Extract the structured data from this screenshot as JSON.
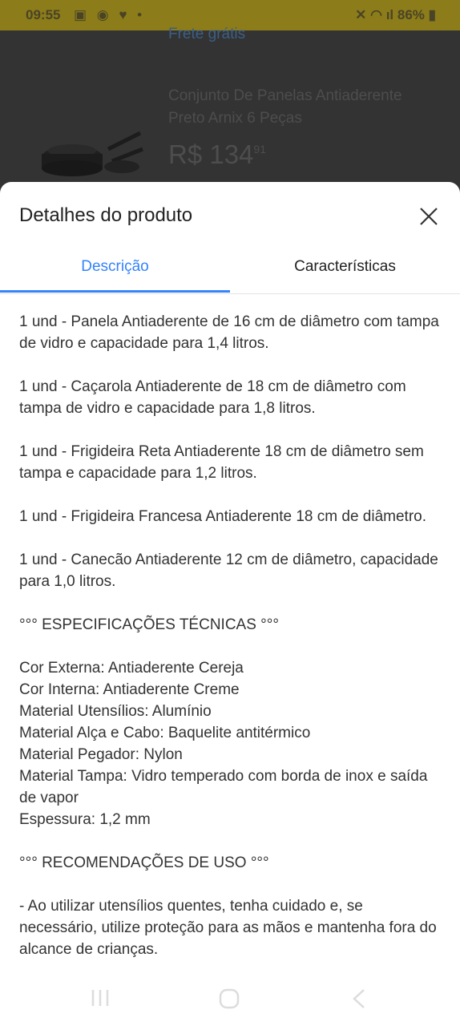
{
  "status": {
    "time": "09:55",
    "battery": "86%"
  },
  "background": {
    "shipping": "Frete grátis",
    "product_name": "Conjunto De Panelas Antiaderente Preto Arnix 6 Peças",
    "price_main": "R$ 134",
    "price_cents": "91"
  },
  "sheet": {
    "title": "Detalhes do produto",
    "tabs": [
      {
        "label": "Descrição",
        "active": true
      },
      {
        "label": "Características",
        "active": false
      }
    ],
    "items": [
      "1 und - Panela Antiaderente de 16 cm de diâmetro com tampa de vidro e capacidade para 1,4 litros.",
      "1 und - Caçarola Antiaderente de 18 cm de diâmetro com tampa de vidro e capacidade para 1,8 litros.",
      "1 und - Frigideira Reta Antiaderente 18 cm de diâmetro sem tampa e capacidade para 1,2 litros.",
      "1 und - Frigideira Francesa Antiaderente 18 cm de diâmetro.",
      "1 und - Canecão Antiaderente 12 cm de diâmetro, capacidade para 1,0 litros."
    ],
    "specs_heading": "°°° ESPECIFICAÇÕES TÉCNICAS °°°",
    "specs": [
      "Cor Externa: Antiaderente Cereja",
      "Cor Interna: Antiaderente Creme",
      "Material Utensílios: Alumínio",
      "Material Alça e Cabo: Baquelite antitérmico",
      "Material Pegador: Nylon",
      "Material Tampa: Vidro temperado com borda de inox e saída de vapor",
      "Espessura: 1,2 mm"
    ],
    "recs_heading": "°°° RECOMENDAÇÕES DE USO °°°",
    "recs_text": "- Ao utilizar utensílios quentes, tenha cuidado e, se necessário, utilize proteção para as mãos e mantenha fora do alcance de crianças."
  },
  "colors": {
    "accent": "#3483fa",
    "text": "#333333"
  },
  "icons": [
    "close-icon",
    "recent-apps-icon",
    "home-icon",
    "back-icon"
  ]
}
